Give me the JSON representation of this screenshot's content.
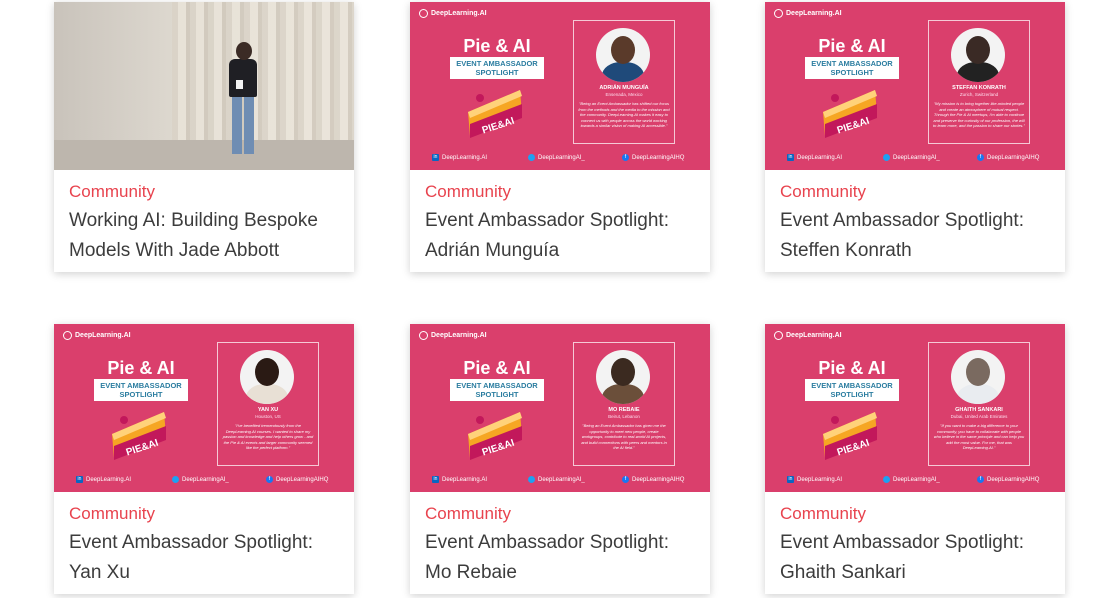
{
  "cards": [
    {
      "category": "Community",
      "title": "Working AI: Building Bespoke Models With Jade Abbott",
      "kind": "photo"
    },
    {
      "category": "Community",
      "title": "Event Ambassador Spotlight: Adrián Munguía",
      "kind": "promo",
      "promo": {
        "brand": "DeepLearning.AI",
        "heading": "Pie & AI",
        "tag": "EVENT AMBASSADOR SPOTLIGHT",
        "name": "ADRIÁN MUNGUÍA",
        "location": "Ensenada, Mexico",
        "quote": "\"Being an Event Ambassador has shifted our focus from the methods and the media to the mission and the community. DeepLearning.AI makes it easy to connect us with people across the world working towards a similar vision of making AI accessible.\"",
        "linkedin": "DeepLearning.AI",
        "twitter": "DeepLearningAI_",
        "facebook": "DeepLearningAIHQ"
      }
    },
    {
      "category": "Community",
      "title": "Event Ambassador Spotlight: Steffen Konrath",
      "kind": "promo",
      "promo": {
        "brand": "DeepLearning.AI",
        "heading": "Pie & AI",
        "tag": "EVENT AMBASSADOR SPOTLIGHT",
        "name": "STEFFAN KONRATH",
        "location": "Zurich, Switzerland",
        "quote": "\"My mission is to bring together like-minded people and create an atmosphere of mutual respect. Through the Pie & AI meetups, I'm able to continue and preserve the curiosity of our profession, the will to learn more, and the passion to share our stories.\"",
        "linkedin": "DeepLearning.AI",
        "twitter": "DeepLearningAI_",
        "facebook": "DeepLearningAIHQ"
      }
    },
    {
      "category": "Community",
      "title": "Event Ambassador Spotlight: Yan Xu",
      "kind": "promo",
      "promo": {
        "brand": "DeepLearning.AI",
        "heading": "Pie & AI",
        "tag": "EVENT AMBASSADOR SPOTLIGHT",
        "name": "YAN XU",
        "location": "Houston, US",
        "quote": "\"I've benefited tremendously from the DeepLearning.AI courses. I wanted to share my passion and knowledge and help others grow - and the Pie & AI events and larger community seemed like the perfect platform.\"",
        "linkedin": "DeepLearning.AI",
        "twitter": "DeepLearningAI_",
        "facebook": "DeepLearningAIHQ"
      }
    },
    {
      "category": "Community",
      "title": "Event Ambassador Spotlight: Mo Rebaie",
      "kind": "promo",
      "promo": {
        "brand": "DeepLearning.AI",
        "heading": "Pie & AI",
        "tag": "EVENT AMBASSADOR SPOTLIGHT",
        "name": "MO REBAIE",
        "location": "Beirut, Lebanon",
        "quote": "\"Being an Event Ambassador has given me the opportunity to meet new people, create workgroups, contribute to real-world AI projects, and build connections with peers and mentors in the AI field.\"",
        "linkedin": "DeepLearning.AI",
        "twitter": "DeepLearningAI_",
        "facebook": "DeepLearningAIHQ"
      }
    },
    {
      "category": "Community",
      "title": "Event Ambassador Spotlight: Ghaith Sankari",
      "kind": "promo",
      "promo": {
        "brand": "DeepLearning.AI",
        "heading": "Pie & AI",
        "tag": "EVENT AMBASSADOR SPOTLIGHT",
        "name": "GHAITH SANKARI",
        "location": "Dubai, United Arab Emirates",
        "quote": "\"If you want to make a big difference to your community, you have to collaborate with people who believe in the same principle and can help you add the most value. For me, that was DeepLearning.AI.\"",
        "linkedin": "DeepLearning.AI",
        "twitter": "DeepLearningAI_",
        "facebook": "DeepLearningAIHQ"
      }
    }
  ],
  "colors": {
    "category": "#e8434e",
    "title": "#3c3c3c",
    "promo_bg": "#da3f6c"
  }
}
